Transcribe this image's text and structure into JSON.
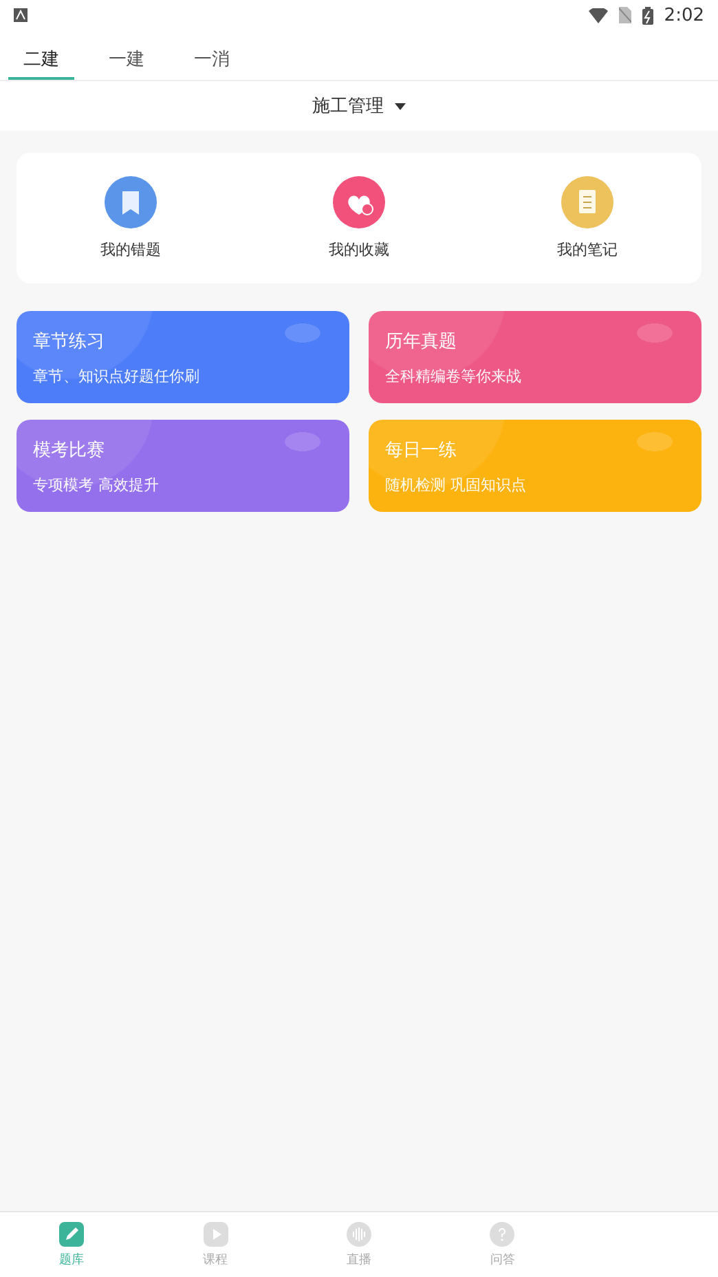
{
  "status_bar": {
    "time": "2:02"
  },
  "tabs": [
    {
      "label": "二建",
      "selected": true
    },
    {
      "label": "一建",
      "selected": false
    },
    {
      "label": "一消",
      "selected": false
    }
  ],
  "subject_selector": {
    "label": "施工管理"
  },
  "shortcuts": [
    {
      "label": "我的错题",
      "kind": "bookmark",
      "color": "#5b95ea"
    },
    {
      "label": "我的收藏",
      "kind": "heart",
      "color": "#f2517c"
    },
    {
      "label": "我的笔记",
      "kind": "note",
      "color": "#edc15c"
    }
  ],
  "cards": [
    {
      "title": "章节练习",
      "subtitle": "章节、知识点好题任你刷",
      "color": "#4e7dfa"
    },
    {
      "title": "历年真题",
      "subtitle": "全科精编卷等你来战",
      "color": "#ee5887"
    },
    {
      "title": "模考比赛",
      "subtitle": "专项模考 高效提升",
      "color": "#9570ec"
    },
    {
      "title": "每日一练",
      "subtitle": "随机检测 巩固知识点",
      "color": "#fdb30f"
    }
  ],
  "bottom_nav": [
    {
      "label": "题库",
      "kind": "pen",
      "selected": true
    },
    {
      "label": "课程",
      "kind": "play",
      "selected": false
    },
    {
      "label": "直播",
      "kind": "wave",
      "selected": false
    },
    {
      "label": "问答",
      "kind": "question",
      "selected": false
    }
  ]
}
